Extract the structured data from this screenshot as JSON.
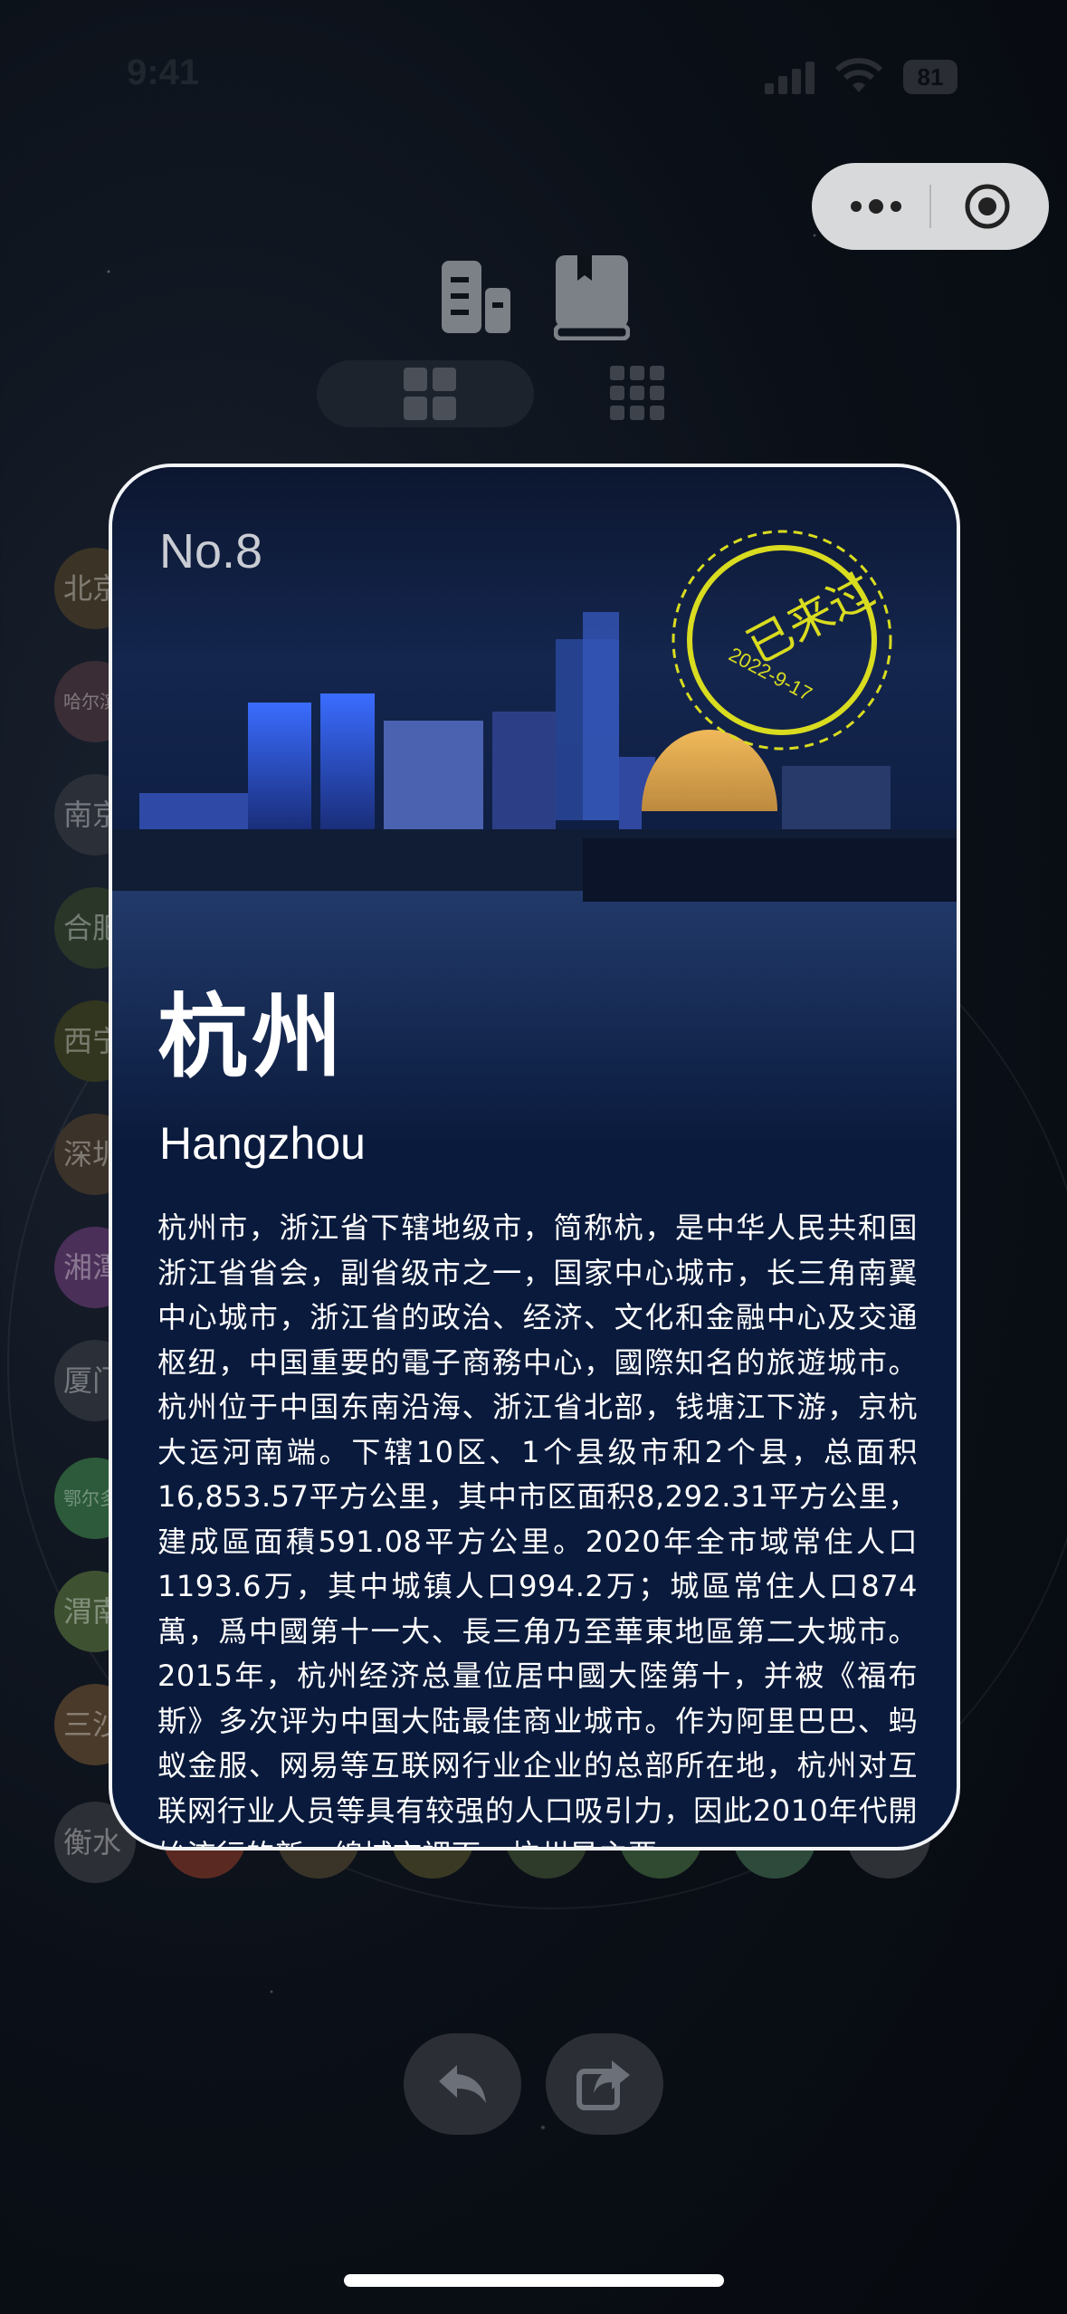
{
  "status_bar": {
    "time": "9:41",
    "battery": "81"
  },
  "nav": {
    "icons": [
      "building-icon",
      "book-icon"
    ],
    "view_modes": [
      "grid-2x2-icon",
      "grid-3x3-icon"
    ]
  },
  "left_cities": [
    "北京",
    "哈尔滨",
    "南京",
    "合肥",
    "西宁",
    "深圳",
    "湘潭",
    "厦门",
    "鄂尔多斯",
    "渭南",
    "三沙",
    "衡水"
  ],
  "card": {
    "number": "No.8",
    "stamp_text": "已来过",
    "stamp_date": "2022-9-17",
    "city_cn": "杭州",
    "city_en": "Hangzhou",
    "description": "杭州市，浙江省下辖地级市，简称杭，是中华人民共和国浙江省省会，副省级市之一，国家中心城市，长三角南翼中心城市，浙江省的政治、经济、文化和金融中心及交通枢纽，中国重要的電子商務中心，國際知名的旅遊城市。杭州位于中国东南沿海、浙江省北部，钱塘江下游，京杭大运河南端。下辖10区、1个县级市和2个县，总面积16,853.57平方公里，其中市区面积8,292.31平方公里，建成區面積591.08平方公里。2020年全市域常住人口1193.6万，其中城镇人口994.2万；城區常住人口874萬，爲中國第十一大、長三角乃至華東地區第二大城市。 2015年，杭州经济总量位居中國大陸第十，并被《福布斯》多次评为中国大陆最佳商业城市。作为阿里巴巴、蚂蚁金服、网易等互联网行业企业的总部所在地，杭州对互联网行业人员等具有较强的人口吸引力，因此2010年代開始流行的新一線城市裡面，杭州是主要"
  },
  "actions": [
    "back-icon",
    "share-icon"
  ],
  "colors": {
    "stamp": "#d9dc1f",
    "card_bg": "#0a1a3c",
    "capsule": "#d8d9db"
  }
}
